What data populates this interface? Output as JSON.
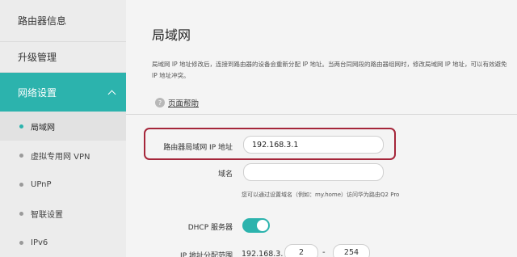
{
  "sidebar": {
    "items": [
      {
        "label": "路由器信息"
      },
      {
        "label": "升级管理"
      },
      {
        "label": "网络设置"
      }
    ],
    "subitems": [
      {
        "label": "局域网"
      },
      {
        "label": "虚拟专用网 VPN"
      },
      {
        "label": "UPnP"
      },
      {
        "label": "智联设置"
      },
      {
        "label": "IPv6"
      }
    ]
  },
  "main": {
    "title": "局域网",
    "description": "局域网 IP 地址修改后，连接到路由器的设备会重新分配 IP 地址。当两台同网段的路由器组网时，修改局域网 IP 地址，可以有效避免 IP 地址冲突。",
    "help_label": "页面帮助",
    "help_icon": "?",
    "form": {
      "ip_label": "路由器局域网 IP 地址",
      "ip_value": "192.168.3.1",
      "domain_label": "域名",
      "domain_value": "",
      "domain_hint": "您可以通过设置域名（例如：my.home）访问华为路由Q2 Pro",
      "dhcp_label": "DHCP 服务器",
      "dhcp_enabled": true,
      "range_label": "IP 地址分配范围",
      "range_prefix": "192.168.3.",
      "range_start": "2",
      "range_dash": "-",
      "range_end": "254"
    }
  },
  "colors": {
    "accent": "#2cb3ad",
    "highlight_border": "#a5263a"
  }
}
